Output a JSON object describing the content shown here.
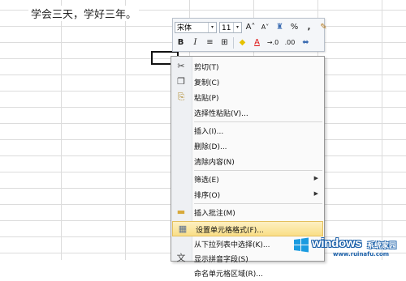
{
  "sheet": {
    "cell_text": "学会三天，学好三年。"
  },
  "minibar": {
    "font_name": "宋体",
    "font_size": "11",
    "grow_font": "A˄",
    "shrink_font": "A˅",
    "accounting": "♜",
    "percent": "%",
    "comma": ",",
    "format_painter": "✎",
    "bold": "B",
    "italic": "I",
    "align": "≡",
    "border": "⊞",
    "fill_color": "◆",
    "font_color": "A",
    "inc_decimal": "→.0",
    "dec_decimal": ".00",
    "merge": "⬌",
    "dropdown": "▾"
  },
  "menu": {
    "items": [
      {
        "label": "剪切(T)",
        "icon": "✂"
      },
      {
        "label": "复制(C)",
        "icon": "❐"
      },
      {
        "label": "粘贴(P)",
        "icon": "⎘"
      },
      {
        "label": "选择性粘贴(V)...",
        "icon": ""
      },
      {
        "label": "插入(I)...",
        "icon": ""
      },
      {
        "label": "删除(D)...",
        "icon": ""
      },
      {
        "label": "清除内容(N)",
        "icon": ""
      },
      {
        "label": "筛选(E)",
        "icon": "",
        "submenu": "▶"
      },
      {
        "label": "排序(O)",
        "icon": "",
        "submenu": "▶"
      },
      {
        "label": "插入批注(M)",
        "icon": "▬"
      },
      {
        "label": "设置单元格格式(F)...",
        "icon": "▦"
      },
      {
        "label": "从下拉列表中选择(K)...",
        "icon": ""
      },
      {
        "label": "显示拼音字段(S)",
        "icon": "文"
      },
      {
        "label": "命名单元格区域(R)...",
        "icon": ""
      }
    ]
  },
  "watermark": {
    "text": "windows",
    "sub": "系统家园",
    "url": "www.ruinafu.com"
  }
}
